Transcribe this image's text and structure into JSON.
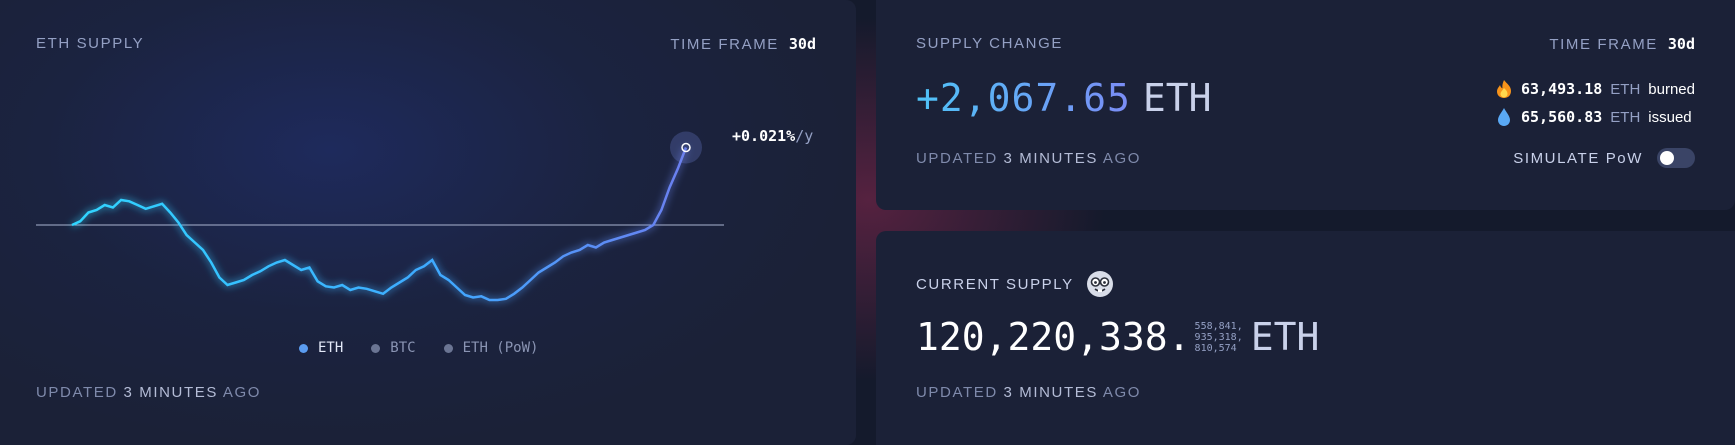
{
  "supply_chart": {
    "title": "ETH SUPPLY",
    "time_frame_label": "TIME FRAME",
    "time_frame_value": "30d",
    "rate_value": "+0.021%",
    "rate_unit": "/y",
    "legend": [
      {
        "label": "ETH",
        "color": "#5b9cf0",
        "active": true
      },
      {
        "label": "BTC",
        "color": "#6b7593",
        "active": false
      },
      {
        "label": "ETH (PoW)",
        "color": "#6b7593",
        "active": false
      }
    ],
    "updated_prefix": "UPDATED",
    "updated_time": "3 MINUTES",
    "updated_suffix": "AGO"
  },
  "chart_data": {
    "type": "line",
    "title": "",
    "xlabel": "",
    "ylabel": "",
    "baseline": 0,
    "ylim": [
      -0.6,
      1.0
    ],
    "series": [
      {
        "name": "ETH",
        "color_start": "#2fd5ff",
        "color_end": "#5b7ff0",
        "values": [
          0,
          0.03,
          0.1,
          0.12,
          0.16,
          0.14,
          0.2,
          0.19,
          0.16,
          0.13,
          0.15,
          0.17,
          0.1,
          0.02,
          -0.08,
          -0.14,
          -0.2,
          -0.3,
          -0.42,
          -0.48,
          -0.46,
          -0.44,
          -0.4,
          -0.37,
          -0.33,
          -0.3,
          -0.28,
          -0.32,
          -0.36,
          -0.34,
          -0.45,
          -0.49,
          -0.5,
          -0.48,
          -0.52,
          -0.5,
          -0.51,
          -0.53,
          -0.55,
          -0.5,
          -0.46,
          -0.42,
          -0.36,
          -0.33,
          -0.28,
          -0.4,
          -0.44,
          -0.5,
          -0.56,
          -0.58,
          -0.57,
          -0.6,
          -0.6,
          -0.59,
          -0.55,
          -0.5,
          -0.44,
          -0.38,
          -0.34,
          -0.3,
          -0.25,
          -0.22,
          -0.2,
          -0.16,
          -0.18,
          -0.14,
          -0.12,
          -0.1,
          -0.08,
          -0.06,
          -0.04,
          0.0,
          0.12,
          0.3,
          0.45,
          0.62
        ]
      }
    ]
  },
  "supply_change": {
    "title": "SUPPLY CHANGE",
    "time_frame_label": "TIME FRAME",
    "time_frame_value": "30d",
    "value": "+2,067.65",
    "unit": "ETH",
    "burned_value": "63,493.18",
    "burned_unit": "ETH",
    "burned_label": "burned",
    "issued_value": "65,560.83",
    "issued_unit": "ETH",
    "issued_label": "issued",
    "updated_prefix": "UPDATED",
    "updated_time": "3 MINUTES",
    "updated_suffix": "AGO",
    "simulate_label": "SIMULATE PoW",
    "simulate_on": false,
    "value_color_start": "#4fc3f7",
    "value_color_end": "#7b8cf5"
  },
  "current_supply": {
    "title": "CURRENT SUPPLY",
    "value_main": "120,220,338.",
    "decimals_line1": "558,841,",
    "decimals_line2": "935,318,",
    "decimals_line3": "810,574",
    "unit": "ETH",
    "updated_prefix": "UPDATED",
    "updated_time": "3 MINUTES",
    "updated_suffix": "AGO"
  }
}
